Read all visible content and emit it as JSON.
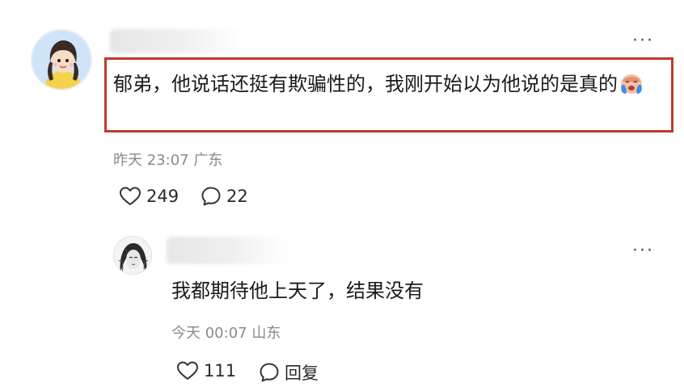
{
  "comment": {
    "text": "郁弟，他说话还挺有欺骗性的，我刚开始以为他说的是真的",
    "emoji_icon": "crying-face-icon",
    "time": "昨天 23:07",
    "location": "广东",
    "likes": "249",
    "comments": "22",
    "more_label": "···"
  },
  "reply": {
    "text": "我都期待他上天了，结果没有",
    "time": "今天 00:07",
    "location": "山东",
    "likes": "111",
    "reply_label": "回复",
    "more_label": "···"
  },
  "colors": {
    "highlight_border": "#c0392b",
    "meta_text": "#8a8a8a"
  }
}
